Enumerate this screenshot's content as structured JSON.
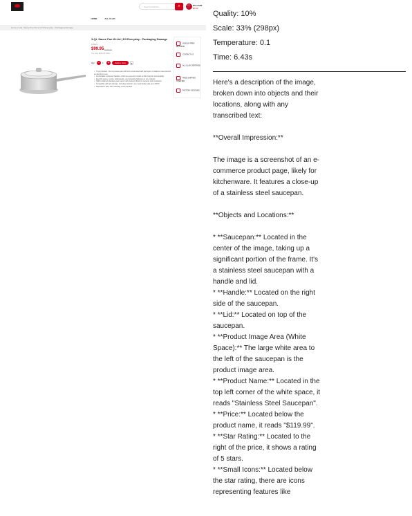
{
  "shop": {
    "search_placeholder": "Search products...",
    "cart_label": "MY CART",
    "cart_total": "$0.00",
    "nav": [
      "HOME",
      "ALL-CLAD"
    ],
    "breadcrumb": "Home | 3-Qt. Sauce Pan W-Lid | D3 Everyday - Packaging Damage",
    "product": {
      "title": "3-Qt. Sauce Pan W-Lid | D3 Everyday - Packaging Damage",
      "sku": "In Stock",
      "price": "$99.95",
      "old_price": "$225.00",
      "saving": "You save $125.05 (56%)",
      "qty_label": "Qty:",
      "qty_value": "1",
      "add_to_cart": "Add to Cart",
      "bullets": [
        "Tri-ply bonded - the 3-qt sauce pan with lid is constructed with two layers of stainless steel around an aluminum core",
        "Comfortable contoured handles, which are securely riveted to offer long life and durability",
        "Ideal for sauces, soups, boiling water, and reheating leftovers on any cooktop",
        "Highly polished stainless steel interior with starburst finish for superior stick resistance",
        "Compatible with all cooktops, including induction; oven and broiler safe up to 600°F",
        "Dishwasher safe; hand washing recommended"
      ]
    },
    "sidebar": [
      "HASSLE-FREE RETURNS",
      "CONTACT US",
      "ALL-CLAD CERTIFIED",
      "FREE SHIPPING OVER $99",
      "FACTORY SECONDS"
    ]
  },
  "meta": {
    "quality": "Quality: 10%",
    "scale": "Scale: 33% (298px)",
    "temperature": "Temperature: 0.1",
    "time": "Time: 6.43s"
  },
  "description": {
    "intro": "Here's a description of the image, broken down into objects and their locations, along with any transcribed text:",
    "overall_heading": "**Overall Impression:**",
    "overall": "The image is a screenshot of an e-commerce product page, likely for kitchenware. It features a close-up of a stainless steel saucepan.",
    "objects_heading": "**Objects and Locations:**",
    "items": [
      "* **Saucepan:** Located in the center of the image, taking up a significant portion of the frame. It's a stainless steel saucepan with a handle and lid.",
      "* **Handle:** Located on the right side of the saucepan.",
      "* **Lid:** Located on top of the saucepan.",
      "* **Product Image Area (White Space):** The large white area to the left of the saucepan is the product image area.",
      "* **Product Name:** Located in the top left corner of the white space, it reads \"Stainless Steel Saucepan\".",
      "* **Price:** Located below the product name, it reads \"$119.99\".",
      "* **Star Rating:** Located to the right of the price, it shows a rating of 5 stars.",
      "* **Small Icons:** Located below the star rating, there are icons representing features like"
    ]
  }
}
